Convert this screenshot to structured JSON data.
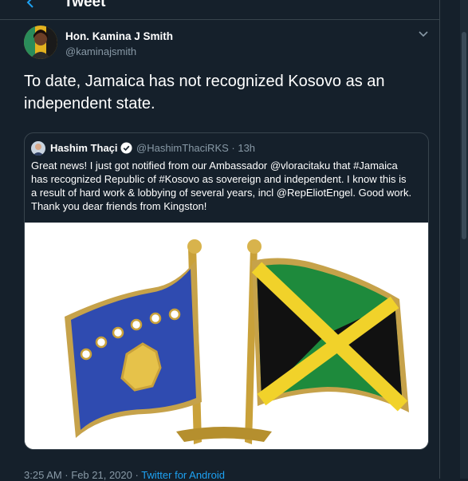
{
  "header": {
    "title": "Tweet"
  },
  "tweet": {
    "author_name": "Hon. Kamina J Smith",
    "author_handle": "@kaminajsmith",
    "text": "To date, Jamaica has not recognized Kosovo as an independent state.",
    "timestamp": "3:25 AM · Feb 21, 2020 · ",
    "source": "Twitter for Android"
  },
  "quoted": {
    "author_name": "Hashim Thaçi",
    "handle_time": "@HashimThaciRKS · 13h",
    "text": "Great news! I just got notified from our Ambassador @vloracitaku that #Jamaica\n has recognized Republic of #Kosovo as sovereign and independent. I know this is\na result of hard work & lobbying of several years, incl @RepEliotEngel. Good work.\nThank you dear friends from Kingston!"
  },
  "colors": {
    "background": "#15202b",
    "border": "#38444d",
    "secondary_text": "#8899a6",
    "link": "#1da1f2"
  }
}
